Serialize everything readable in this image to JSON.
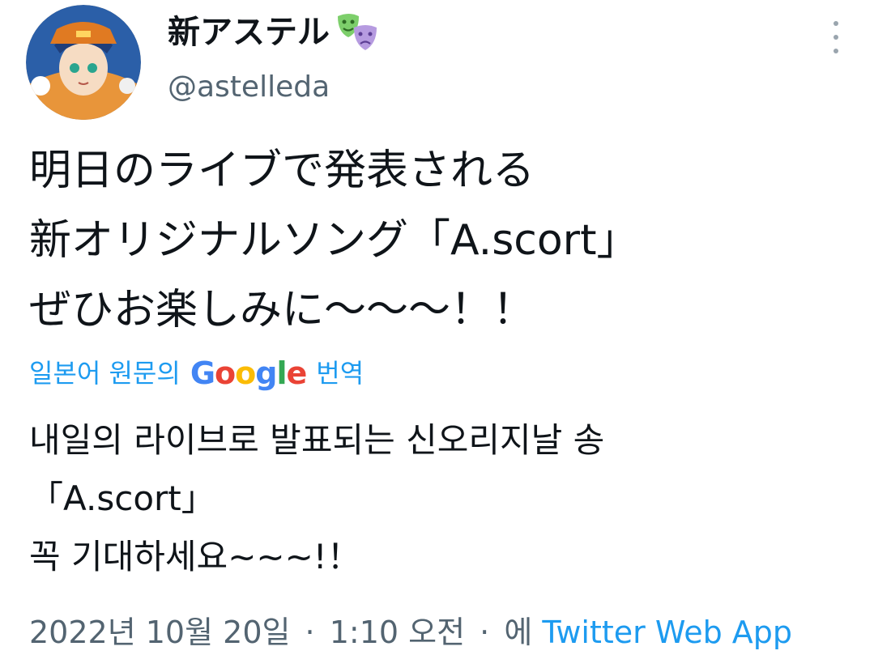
{
  "author": {
    "display_name": "新アステル",
    "handle": "@astelleda",
    "emoji_icon": "performing-arts-masks-icon",
    "avatar_icon": "anime-character-avatar"
  },
  "more_menu_icon": "more-vertical-icon",
  "tweet": {
    "lines": [
      "明日のライブで発表される",
      "新オリジナルソング「A.scort」",
      "ぜひお楽しみに〜〜〜！！"
    ]
  },
  "translation": {
    "prefix": "일본어 원문의",
    "brand": "Google",
    "suffix": "번역",
    "lines": [
      "내일의 라이브로 발표되는 신오리지날 송",
      "「A.scort」",
      "꼭 기대하세요~~~!！"
    ]
  },
  "meta": {
    "date": "2022년 10월 20일",
    "separator": "·",
    "time": "1:10 오전",
    "via": "에",
    "source": "Twitter Web App"
  },
  "colors": {
    "link_blue": "#1d9bf0",
    "muted_gray": "#536471",
    "text": "#0f1419"
  }
}
